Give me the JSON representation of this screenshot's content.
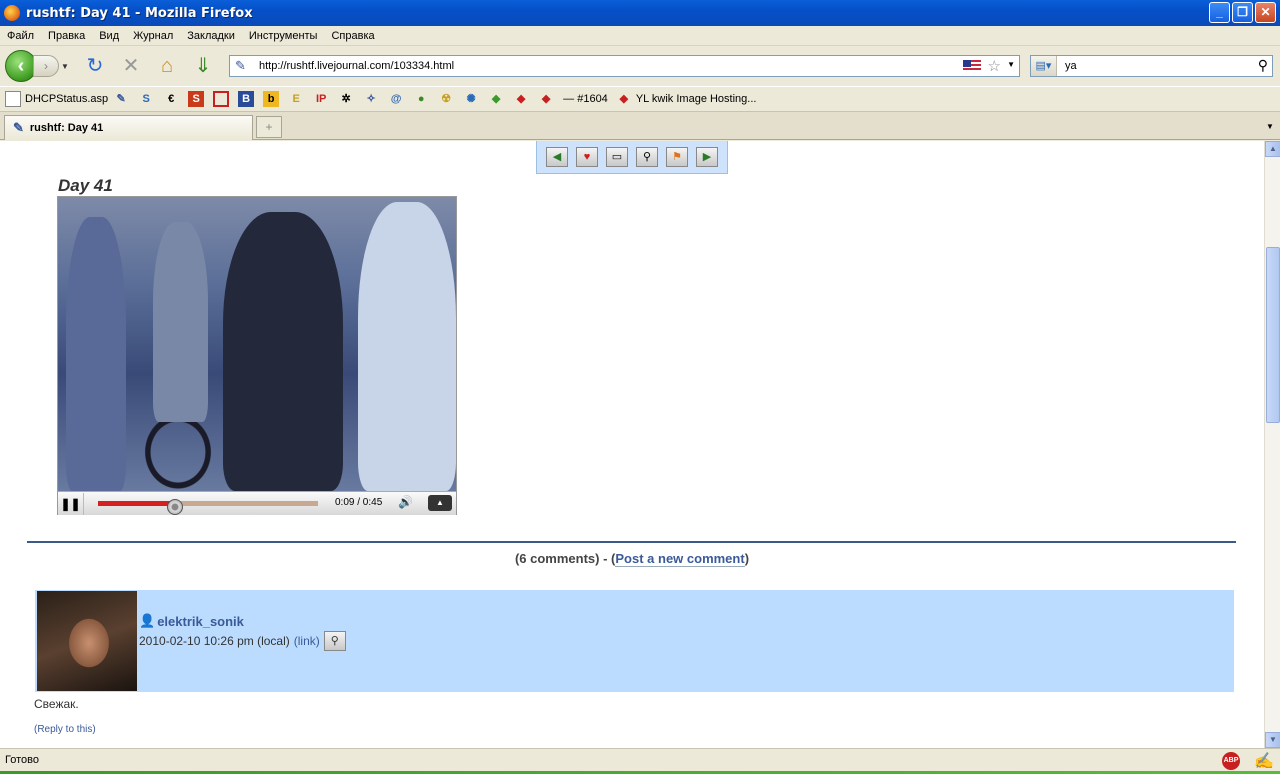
{
  "window": {
    "title": "rushtf: Day 41 - Mozilla Firefox",
    "buttons": [
      "_",
      "❐",
      "✕"
    ]
  },
  "menu": [
    "Файл",
    "Правка",
    "Вид",
    "Журнал",
    "Закладки",
    "Инструменты",
    "Справка"
  ],
  "navbar": {
    "url": "http://rushtf.livejournal.com/103334.html",
    "search_query": "ya"
  },
  "bookmarks": {
    "first": "DHCPStatus.asp",
    "icons": [
      "S",
      "€",
      "S",
      "B",
      "b",
      "E",
      "IP",
      "@"
    ],
    "item_1604": "— #1604",
    "kwik": "YL kwik Image Hosting..."
  },
  "tab": {
    "label": "rushtf: Day 41",
    "new_tab": "+"
  },
  "post": {
    "title": "Day 41",
    "video": {
      "current_time": "0:09",
      "duration": "0:45",
      "time_text": "0:09 / 0:45",
      "progress_fraction": 0.35
    }
  },
  "comments": {
    "count_text": "(6 comments)",
    "separator": " - (",
    "post_link": "Post a new comment",
    "close_paren": ")",
    "items": [
      {
        "username": "elektrik_sonik",
        "date": "2010-02-10 10:26 pm (local)",
        "link_label": "(link)",
        "text": "Свежак.",
        "reply_label": "(Reply to this)"
      }
    ]
  },
  "status": {
    "text": "Готово",
    "abp": "ABP"
  },
  "colors": {
    "comment_bg": "#bcdcff",
    "link": "#3a5a9a",
    "progress": "#d62020"
  }
}
